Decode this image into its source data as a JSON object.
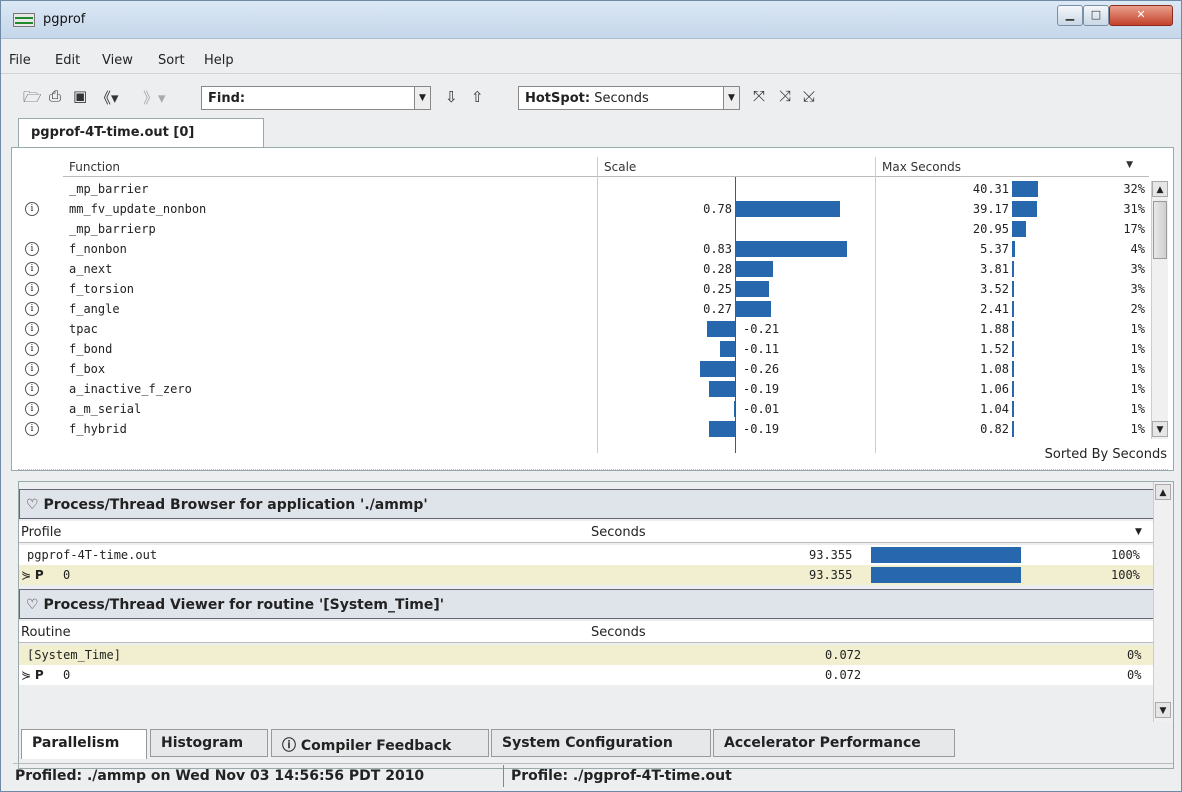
{
  "window": {
    "title": "pgprof"
  },
  "menu": [
    "File",
    "Edit",
    "View",
    "Sort",
    "Help"
  ],
  "toolbar": {
    "find_label": "Find:",
    "hotspot_label": "HotSpot:",
    "hotspot_value": "Seconds"
  },
  "tab_top": "pgprof-4T-time.out [0]",
  "function_table": {
    "headers": {
      "function": "Function",
      "scale": "Scale",
      "max_seconds": "Max Seconds"
    },
    "rows": [
      {
        "info": false,
        "name": "_mp_barrier",
        "scale": "",
        "scale_value": 0,
        "seconds": "40.31",
        "seconds_value": 40.31,
        "pct": "32%"
      },
      {
        "info": true,
        "name": "mm_fv_update_nonbon",
        "scale": "0.78",
        "scale_value": 0.78,
        "seconds": "39.17",
        "seconds_value": 39.17,
        "pct": "31%"
      },
      {
        "info": false,
        "name": "_mp_barrierp",
        "scale": "",
        "scale_value": 0,
        "seconds": "20.95",
        "seconds_value": 20.95,
        "pct": "17%"
      },
      {
        "info": true,
        "name": "f_nonbon",
        "scale": "0.83",
        "scale_value": 0.83,
        "seconds": "5.37",
        "seconds_value": 5.37,
        "pct": "4%"
      },
      {
        "info": true,
        "name": "a_next",
        "scale": "0.28",
        "scale_value": 0.28,
        "seconds": "3.81",
        "seconds_value": 3.81,
        "pct": "3%"
      },
      {
        "info": true,
        "name": "f_torsion",
        "scale": "0.25",
        "scale_value": 0.25,
        "seconds": "3.52",
        "seconds_value": 3.52,
        "pct": "3%"
      },
      {
        "info": true,
        "name": "f_angle",
        "scale": "0.27",
        "scale_value": 0.27,
        "seconds": "2.41",
        "seconds_value": 2.41,
        "pct": "2%"
      },
      {
        "info": true,
        "name": "tpac",
        "scale": "-0.21",
        "scale_value": -0.21,
        "seconds": "1.88",
        "seconds_value": 1.88,
        "pct": "1%"
      },
      {
        "info": true,
        "name": "f_bond",
        "scale": "-0.11",
        "scale_value": -0.11,
        "seconds": "1.52",
        "seconds_value": 1.52,
        "pct": "1%"
      },
      {
        "info": true,
        "name": "f_box",
        "scale": "-0.26",
        "scale_value": -0.26,
        "seconds": "1.08",
        "seconds_value": 1.08,
        "pct": "1%"
      },
      {
        "info": true,
        "name": "a_inactive_f_zero",
        "scale": "-0.19",
        "scale_value": -0.19,
        "seconds": "1.06",
        "seconds_value": 1.06,
        "pct": "1%"
      },
      {
        "info": true,
        "name": "a_m_serial",
        "scale": "-0.01",
        "scale_value": -0.01,
        "seconds": "1.04",
        "seconds_value": 1.04,
        "pct": "1%"
      },
      {
        "info": true,
        "name": "f_hybrid",
        "scale": "-0.19",
        "scale_value": -0.19,
        "seconds": "0.82",
        "seconds_value": 0.82,
        "pct": "1%"
      }
    ],
    "sorted_by": "Sorted By Seconds"
  },
  "process_browser": {
    "title": "Process/Thread Browser for application './ammp'",
    "col_profile": "Profile",
    "col_seconds": "Seconds",
    "rows": [
      {
        "name": "pgprof-4T-time.out",
        "seconds": "93.355",
        "fraction": 1.0,
        "pct": "100%",
        "selected": false,
        "thread": false
      },
      {
        "name": "0",
        "seconds": "93.355",
        "fraction": 1.0,
        "pct": "100%",
        "selected": true,
        "thread": true
      }
    ]
  },
  "process_viewer": {
    "title": "Process/Thread Viewer for routine '[System_Time]'",
    "col_routine": "Routine",
    "col_seconds": "Seconds",
    "rows": [
      {
        "name": "[System_Time]",
        "seconds": "0.072",
        "pct": "0%",
        "selected": true,
        "thread": false
      },
      {
        "name": "0",
        "seconds": "0.072",
        "pct": "0%",
        "selected": false,
        "thread": true
      }
    ]
  },
  "bottom_tabs": [
    "Parallelism",
    "Histogram",
    "Compiler Feedback",
    "System Configuration",
    "Accelerator Performance"
  ],
  "status": {
    "profiled": "Profiled: ./ammp on Wed Nov 03 14:56:56 PDT 2010",
    "profile": "Profile: ./pgprof-4T-time.out"
  },
  "colors": {
    "bar": "#2767ad",
    "selected_row": "#f1efd0"
  }
}
